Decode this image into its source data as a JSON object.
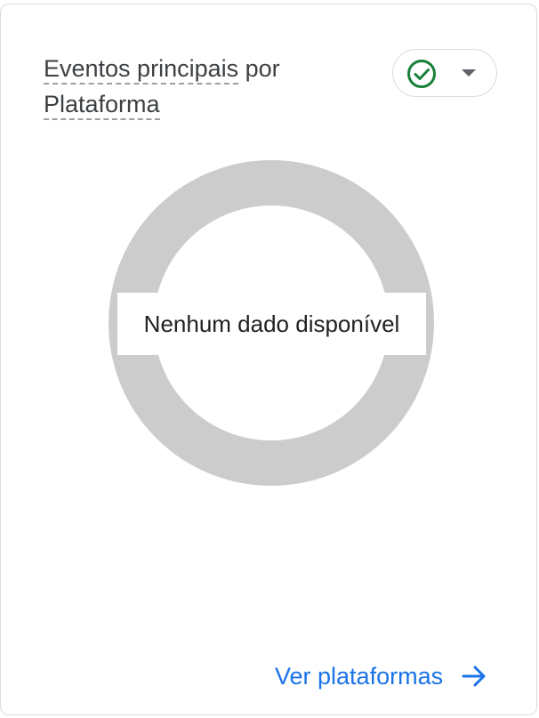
{
  "card": {
    "title_line1": "Eventos principais",
    "title_line1_suffix": " por",
    "title_line2": "Plataforma",
    "status_icon": "check-circle-icon",
    "dropdown_icon": "arrow-drop-down-icon",
    "empty_message": "Nenhum dado disponível",
    "link_label": "Ver plataformas",
    "link_icon": "arrow-forward-icon"
  },
  "colors": {
    "donut_empty": "#cccccc",
    "status_ok": "#188038",
    "link": "#1a73e8",
    "title_text": "#3c4043"
  }
}
